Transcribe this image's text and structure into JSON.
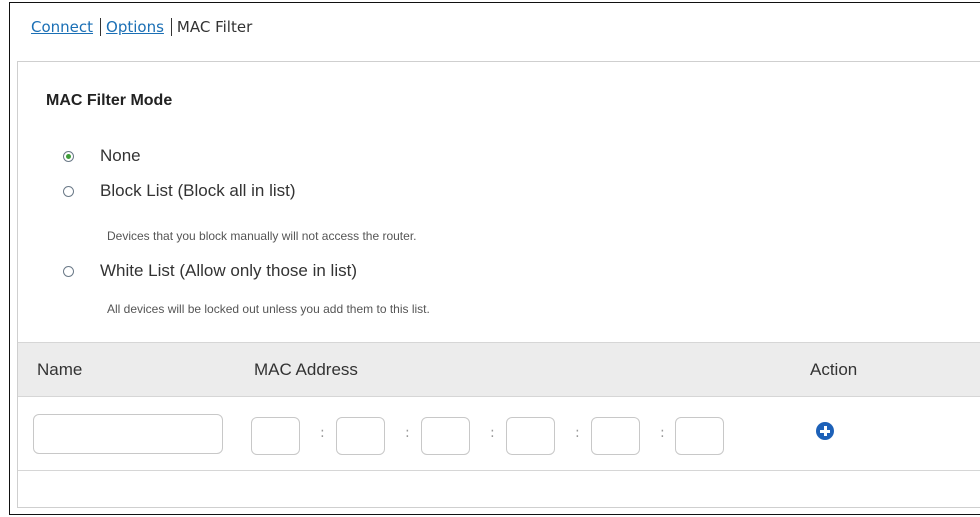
{
  "breadcrumb": {
    "connect": "Connect",
    "options": "Options",
    "current": "MAC Filter"
  },
  "mode": {
    "title": "MAC Filter Mode",
    "options": [
      {
        "label": "None",
        "selected": true,
        "hint": ""
      },
      {
        "label": "Block List (Block all in list)",
        "selected": false,
        "hint": "Devices that you block manually will not access the router."
      },
      {
        "label": "White List (Allow only those in list)",
        "selected": false,
        "hint": "All devices will be locked out unless you add them to this list."
      }
    ]
  },
  "table": {
    "headers": {
      "name": "Name",
      "mac": "MAC Address",
      "action": "Action"
    },
    "row": {
      "name_value": "",
      "mac_octets": [
        "",
        "",
        "",
        "",
        "",
        ""
      ],
      "separator": ":"
    }
  },
  "icons": {
    "add": "add-icon",
    "radio_selected_color": "#3e9d3a",
    "add_color": "#1d61b8"
  }
}
